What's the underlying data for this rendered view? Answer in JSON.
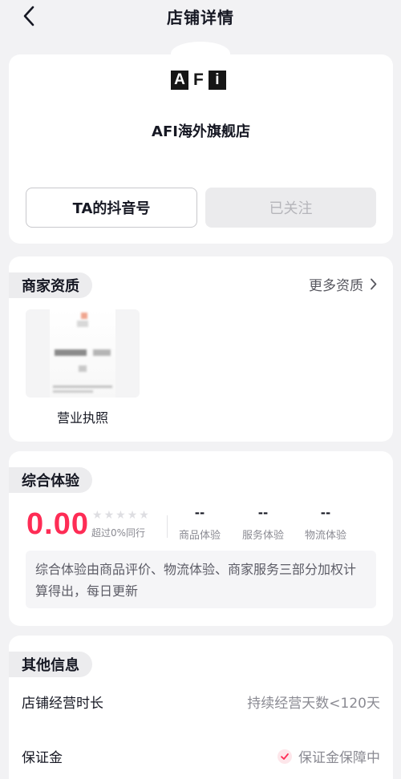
{
  "header": {
    "title": "店铺详情"
  },
  "store": {
    "logo_letters": [
      "A",
      "F",
      "i"
    ],
    "name": "AFI海外旗舰店",
    "douyin_button": "TA的抖音号",
    "follow_button": "已关注"
  },
  "qualifications": {
    "section_title": "商家资质",
    "more_link": "更多资质",
    "license_label": "营业执照"
  },
  "experience": {
    "section_title": "综合体验",
    "score": "0.00",
    "stars": 5,
    "beat_text": "超过0%同行",
    "metrics": [
      {
        "value": "--",
        "label": "商品体验"
      },
      {
        "value": "--",
        "label": "服务体验"
      },
      {
        "value": "--",
        "label": "物流体验"
      }
    ],
    "note": "综合体验由商品评价、物流体验、商家服务三部分加权计算得出，每日更新"
  },
  "other": {
    "section_title": "其他信息",
    "rows": [
      {
        "label": "店铺经营时长",
        "value": "持续经营天数<120天"
      },
      {
        "label": "保证金",
        "value": "保证金保障中"
      }
    ]
  },
  "colors": {
    "accent": "#fe2c55",
    "background": "#f2f2f4",
    "card": "#ffffff"
  }
}
